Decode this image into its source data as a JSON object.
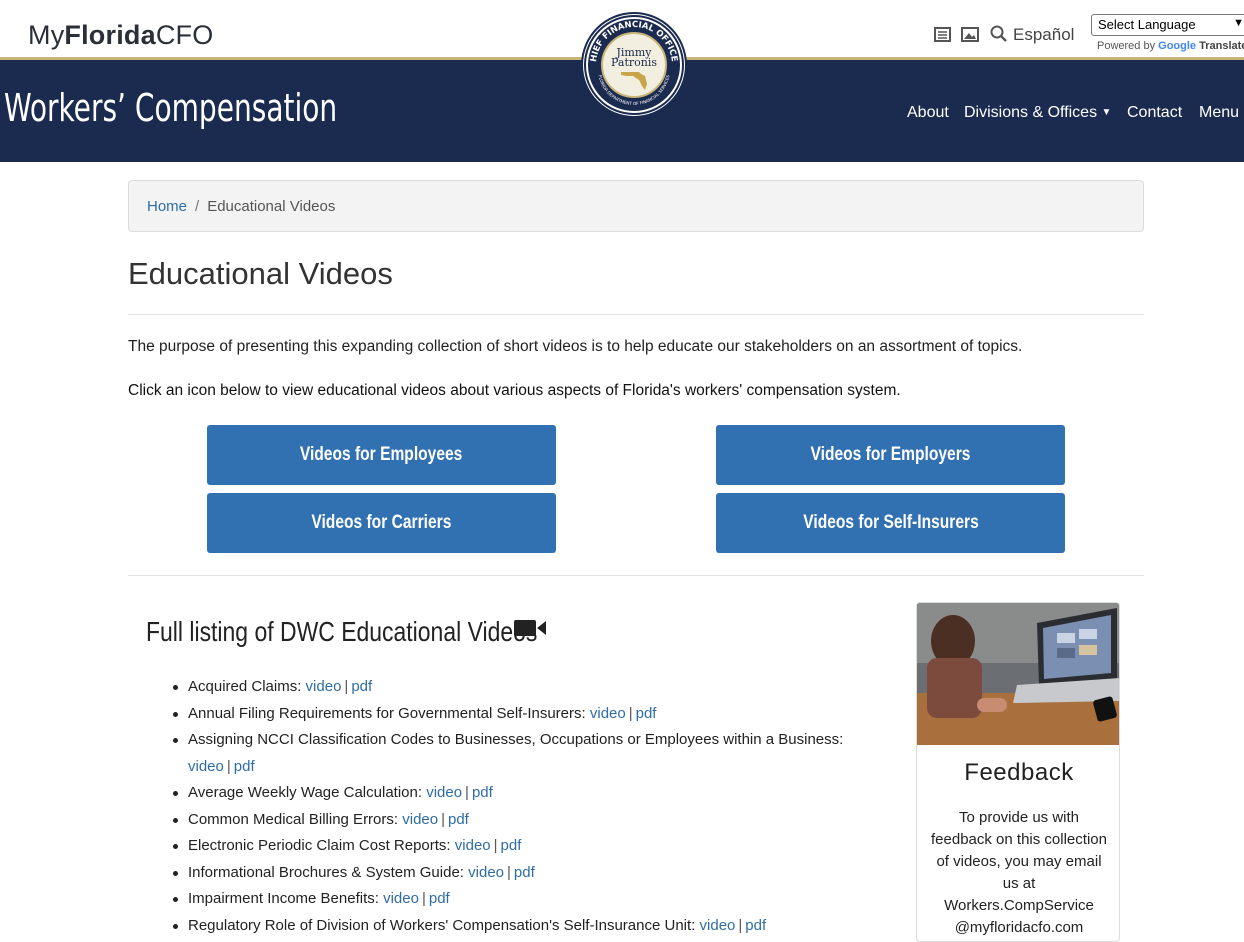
{
  "topbar": {
    "logo_prefix": "My",
    "logo_bold": "Florida",
    "logo_suffix": "CFO",
    "espanol": "Español",
    "language_select": "Select Language",
    "powered_by": "Powered by",
    "google": "Google",
    "translate": "Translate"
  },
  "seal": {
    "line1": "CHIEF FINANCIAL OFFICER",
    "name1": "Jimmy",
    "name2": "Patronis",
    "bottom": "FLORIDA DEPARTMENT OF FINANCIAL SERVICES"
  },
  "header": {
    "site_title": "Workers’ Compensation",
    "nav": [
      "About",
      "Divisions & Offices",
      "Contact",
      "Menu"
    ]
  },
  "breadcrumb": {
    "home": "Home",
    "sep": "/",
    "current": "Educational Videos"
  },
  "page_title": "Educational Videos",
  "intro": "The purpose of presenting this expanding collection of short videos is to help educate our stakeholders on an assortment of topics.",
  "instruction": "Click an icon below to view educational videos about various aspects of Florida's workers' compensation system.",
  "buttons": [
    "Videos for Employees",
    "Videos for Employers",
    "Videos for Carriers",
    "Videos for Self-Insurers"
  ],
  "listing_title": "Full listing of DWC Educational Videos",
  "videos": [
    {
      "title": "Acquired Claims:",
      "video": "video",
      "pdf": "pdf"
    },
    {
      "title": "Annual Filing Requirements for Governmental Self-Insurers:",
      "video": "video",
      "pdf": "pdf"
    },
    {
      "title": "Assigning NCCI Classification Codes to Businesses, Occupations or Employees within a Business:",
      "video": "video",
      "pdf": "pdf"
    },
    {
      "title": "Average Weekly Wage Calculation:",
      "video": "video",
      "pdf": "pdf"
    },
    {
      "title": "Common Medical Billing Errors:",
      "video": "video",
      "pdf": "pdf"
    },
    {
      "title": "Electronic Periodic Claim Cost Reports:",
      "video": "video",
      "pdf": "pdf"
    },
    {
      "title": "Informational Brochures & System Guide:",
      "video": "video",
      "pdf": "pdf"
    },
    {
      "title": "Impairment Income Benefits:",
      "video": "video",
      "pdf": "pdf"
    },
    {
      "title": "Regulatory Role of Division of Workers' Compensation's Self-Insurance Unit:",
      "video": "video",
      "pdf": "pdf"
    }
  ],
  "feedback": {
    "title": "Feedback",
    "text": "To provide us with feedback on this collection of videos, you may email us at Workers.CompService @myfloridacfo.com"
  }
}
